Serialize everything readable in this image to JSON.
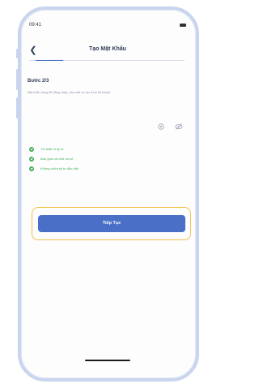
{
  "status_bar": {
    "time": "09:41"
  },
  "header": {
    "back_icon": "chevron-left-icon",
    "title": "Tạo Mật Khẩu"
  },
  "step": {
    "label": "Bước 2/3"
  },
  "description": "Mật khẩu dùng để đăng nhập, bảo mật và xác thực tài khoản",
  "password_visibility_icons": [
    "eye-icon",
    "eye-off-icon"
  ],
  "rules": [
    {
      "text": "Tối thiểu 8 ký tự",
      "icon": "check-circle-icon"
    },
    {
      "text": "Bao gồm cả chữ và số",
      "icon": "check-circle-icon"
    },
    {
      "text": "Không chứa ký tự đặc biệt",
      "icon": "check-circle-icon"
    }
  ],
  "continue_button": {
    "label": "Tiếp Tục"
  },
  "colors": {
    "accent": "#4a6fc7",
    "success": "#3fae5a",
    "highlight": "#f1c14b",
    "frame": "#c9d4ee"
  }
}
